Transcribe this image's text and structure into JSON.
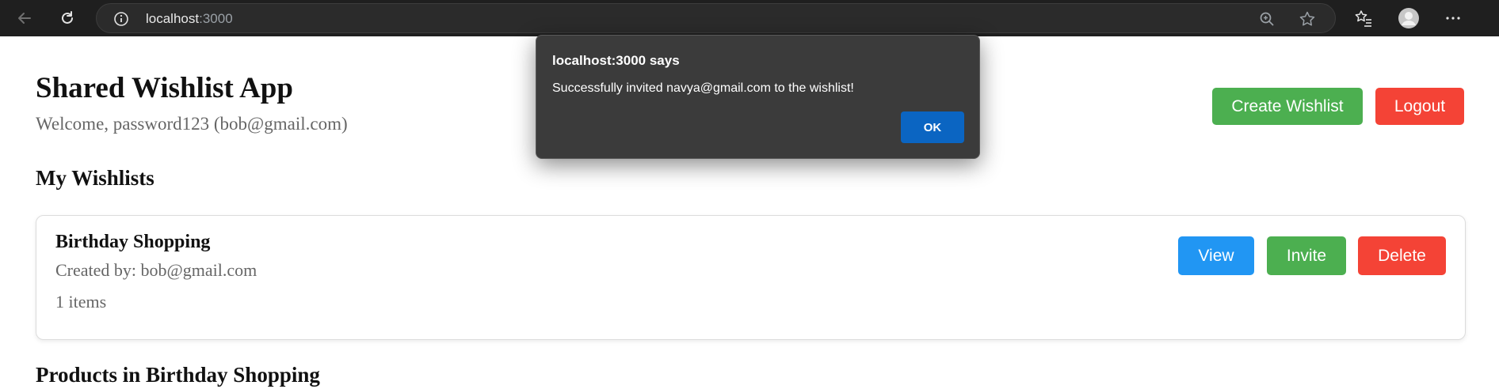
{
  "browser": {
    "url_host": "localhost",
    "url_port": ":3000",
    "icons": [
      "back-icon",
      "reload-icon",
      "site-info-icon",
      "zoom-icon",
      "favorite-star-icon",
      "favorites-icon",
      "profile-icon",
      "more-icon"
    ]
  },
  "header": {
    "title": "Shared Wishlist App",
    "welcome": "Welcome, password123 (bob@gmail.com)",
    "create_label": "Create Wishlist",
    "logout_label": "Logout"
  },
  "wishlists": {
    "heading": "My Wishlists",
    "items": [
      {
        "name": "Birthday Shopping",
        "created_by": "Created by: bob@gmail.com",
        "count": "1 items",
        "view_label": "View",
        "invite_label": "Invite",
        "delete_label": "Delete"
      }
    ]
  },
  "products": {
    "heading": "Products in Birthday Shopping"
  },
  "dialog": {
    "title": "localhost:3000 says",
    "message": "Successfully invited navya@gmail.com to the wishlist!",
    "ok_label": "OK"
  },
  "colors": {
    "green": "#4caf50",
    "red": "#f44336",
    "blue": "#2196f3",
    "dialog_bg": "#3b3b3b",
    "dialog_ok": "#0b65c2"
  }
}
